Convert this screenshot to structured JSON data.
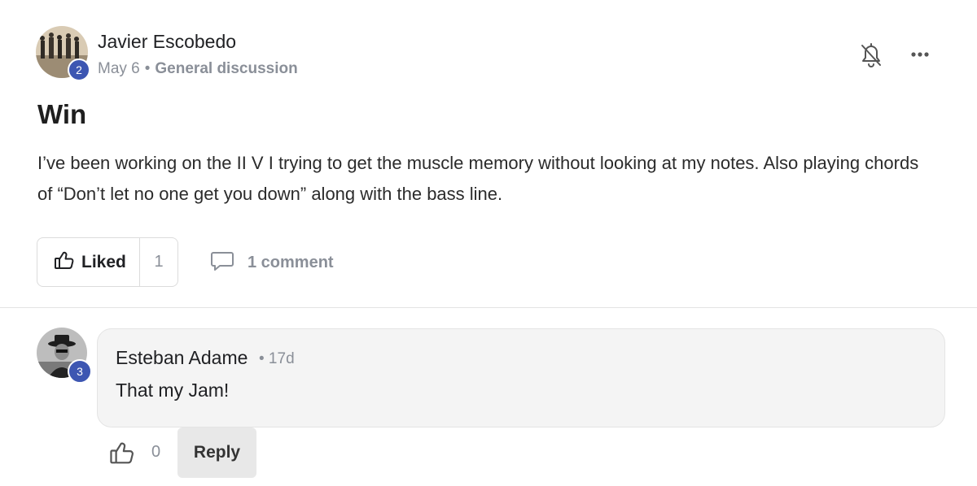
{
  "post": {
    "author": {
      "name": "Javier Escobedo",
      "level": "2"
    },
    "date": "May 6",
    "separator": "•",
    "category": "General discussion",
    "title": "Win",
    "body": "I’ve been working on the II V I trying to get the muscle memory without looking at my notes. Also playing chords of “Don’t let no one get you down” along with the bass line.",
    "actions": {
      "like_label": "Liked",
      "like_count": "1",
      "comment_label": "1 comment"
    },
    "icons": {
      "notification": "bell-off-icon",
      "more": "more-horizontal-icon",
      "like": "thumbs-up-icon",
      "comment": "comment-bubble-icon"
    }
  },
  "comments": [
    {
      "author": "Esteban Adame",
      "level": "3",
      "time": "• 17d",
      "text": "That my Jam!",
      "like_count": "0",
      "reply_label": "Reply"
    }
  ],
  "colors": {
    "level_badge": "#3d56b2",
    "muted_text": "#8a8f98",
    "comment_bubble": "#f4f4f4",
    "reply_button": "#e8e8e8"
  }
}
